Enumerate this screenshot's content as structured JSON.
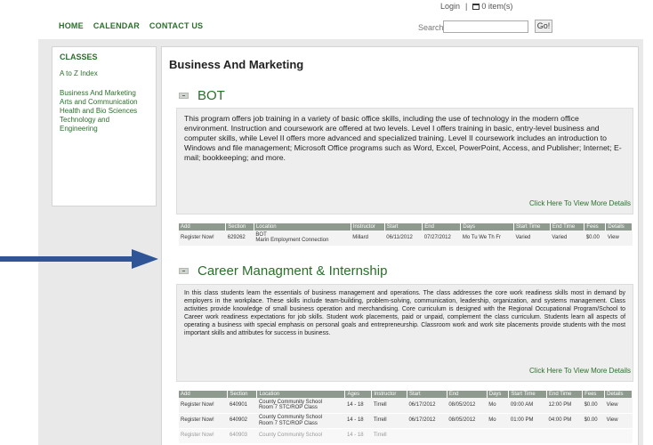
{
  "header": {
    "login": "Login",
    "separator": "|",
    "cart": "0 item(s)",
    "search_label": "Search",
    "search_value": "",
    "go_label": "Go!"
  },
  "nav": [
    "HOME",
    "CALENDAR",
    "CONTACT US"
  ],
  "sidebar": {
    "title": "CLASSES",
    "index_link": "A to Z Index",
    "items": [
      "Business And Marketing",
      "Arts and Communication",
      "Health and Bio Sciences",
      "Technology and Engineering"
    ]
  },
  "page_title": "Business And Marketing",
  "courses": [
    {
      "title": "BOT",
      "description": "This program offers job training in a variety of basic office skills, including the use of technology in the modern office environment. Instruction and coursework are offered at two levels. Level I offers training in basic, entry-level business and computer skills, while Level II offers more advanced and specialized training. Level II coursework includes an introduction to Windows and file management; Microsoft Office programs such as Word, Excel, PowerPoint, Access, and Publisher; Internet; E-mail; bookkeeping; and more.",
      "more_link": "Click Here To View More Details",
      "columns": [
        "Add",
        "Section",
        "Location",
        "Instructor",
        "Start",
        "End",
        "Days",
        "Start Time",
        "End Time",
        "Fees",
        "Details"
      ],
      "rows": [
        [
          "Register Now!",
          "629262",
          "BOT\nMarin Employment Connection",
          "Millard",
          "06/11/2012",
          "07/27/2012",
          "Mo Tu We Th Fr",
          "Varied",
          "Varied",
          "$0.00",
          "View"
        ]
      ]
    },
    {
      "title": "Career Managment & Internship",
      "description": "In this class students learn the essentials of business management and operations. The class addresses the core work readiness skills most in demand by employers in the workplace. These skills include team-building, problem-solving, communication, leadership, organization, and systems management. Class activities provide knowledge of small business operation and merchandising. Core curriculum is designed with the Regional Occupational Program/School to Career work readiness expectations for job skills. Student work placements, paid or unpaid, complement the class curriculum. Students learn all aspects of operating a business with special emphasis on personal goals and entrepreneurship. Classroom work and work site placements provide students with the most important skills and attributes for success in business.",
      "more_link": "Click Here To View More Details",
      "columns": [
        "Add",
        "Section",
        "Location",
        "Ages",
        "Instructor",
        "Start",
        "End",
        "Days",
        "Start Time",
        "End Time",
        "Fees",
        "Details"
      ],
      "rows": [
        [
          "Register Now!",
          "640901",
          "County Community School\nRoom 7 STC/ROP Class",
          "14 - 18",
          "Tirrell",
          "06/17/2012",
          "08/05/2012",
          "Mo",
          "09:00 AM",
          "12:00 PM",
          "$0.00",
          "View"
        ],
        [
          "Register Now!",
          "640902",
          "County Community School\nRoom 7 STC/ROP Class",
          "14 - 18",
          "Tirrell",
          "06/17/2012",
          "08/05/2012",
          "Mo",
          "01:00 PM",
          "04:00 PM",
          "$0.00",
          "View"
        ],
        [
          "Register Now!",
          "640903",
          "County Community School",
          "14 - 18",
          "Tirrell",
          "",
          "",
          "",
          "",
          "",
          "",
          ""
        ]
      ]
    }
  ],
  "colors": {
    "brand_green": "#2b6f2b",
    "arrow": "#2f5597",
    "table_header": "#8f9a8f"
  }
}
